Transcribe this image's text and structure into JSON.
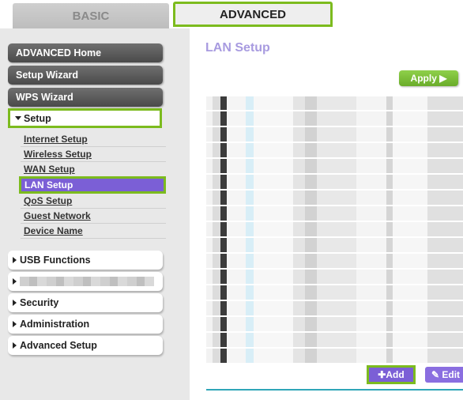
{
  "tabs": {
    "basic": "BASIC",
    "advanced": "ADVANCED"
  },
  "sidebar": {
    "buttons": [
      "ADVANCED Home",
      "Setup Wizard",
      "WPS Wizard"
    ],
    "setup_label": "Setup",
    "sub_items": [
      "Internet Setup",
      "Wireless Setup",
      "WAN Setup",
      "LAN Setup",
      "QoS Setup",
      "Guest Network",
      "Device Name"
    ],
    "active_sub": "LAN Setup",
    "sections": [
      "USB Functions",
      "",
      "Security",
      "Administration",
      "Advanced Setup"
    ]
  },
  "main": {
    "title": "LAN Setup",
    "apply_label": "Apply ▶",
    "add_label": "✚Add",
    "edit_label": "✎ Edit"
  },
  "colors": {
    "accent_green": "#7cbb1e",
    "active_purple": "#7b5fd6",
    "title_lavender": "#a89be0",
    "divider_teal": "#2fa6b8"
  }
}
